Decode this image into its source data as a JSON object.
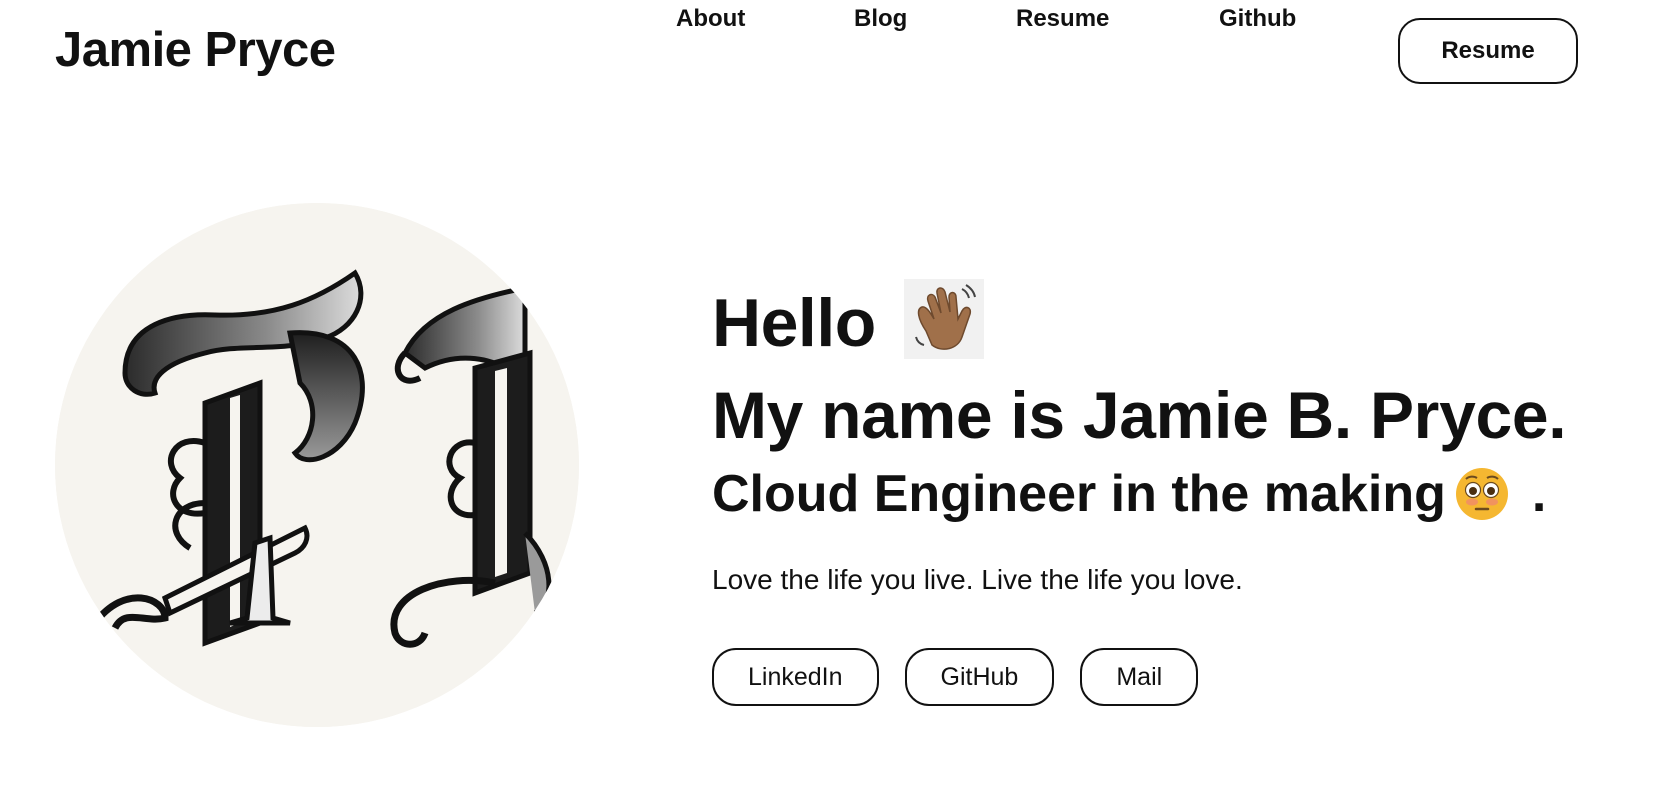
{
  "brand": "Jamie Pryce",
  "nav": {
    "links": [
      "About",
      "Blog",
      "Resume",
      "Github"
    ],
    "cta_label": "Resume"
  },
  "hero": {
    "greeting": "Hello",
    "name_line": "My name is Jamie B. Pryce.",
    "role_text": "Cloud Engineer in the making",
    "role_suffix": ".",
    "tagline": "Love the life you live. Live the life you love.",
    "social": [
      "LinkedIn",
      "GitHub",
      "Mail"
    ]
  },
  "icons": {
    "greeting_emoji": "waving-hand",
    "role_emoji": "flushed-face"
  },
  "colors": {
    "text": "#111111",
    "background": "#ffffff",
    "emoji_skin": "#a0704a",
    "emoji_face": "#f5b731"
  }
}
